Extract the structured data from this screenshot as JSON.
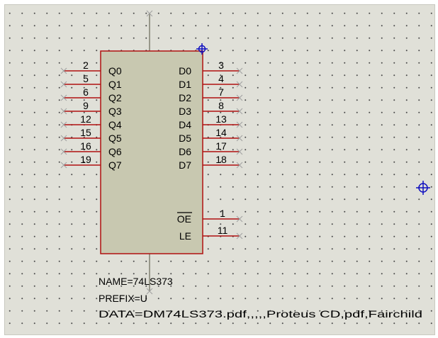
{
  "component": {
    "left_pins": [
      {
        "num": "2",
        "name": "Q0"
      },
      {
        "num": "5",
        "name": "Q1"
      },
      {
        "num": "6",
        "name": "Q2"
      },
      {
        "num": "9",
        "name": "Q3"
      },
      {
        "num": "12",
        "name": "Q4"
      },
      {
        "num": "15",
        "name": "Q5"
      },
      {
        "num": "16",
        "name": "Q6"
      },
      {
        "num": "19",
        "name": "Q7"
      }
    ],
    "right_pins": [
      {
        "num": "3",
        "name": "D0"
      },
      {
        "num": "4",
        "name": "D1"
      },
      {
        "num": "7",
        "name": "D2"
      },
      {
        "num": "8",
        "name": "D3"
      },
      {
        "num": "13",
        "name": "D4"
      },
      {
        "num": "14",
        "name": "D5"
      },
      {
        "num": "17",
        "name": "D6"
      },
      {
        "num": "18",
        "name": "D7"
      }
    ],
    "control_pins": [
      {
        "num": "1",
        "name": "OE",
        "overbar": true
      },
      {
        "num": "11",
        "name": "LE",
        "overbar": false
      }
    ],
    "properties": {
      "name": "NAME=74LS373",
      "prefix": "PREFIX=U",
      "data": "DATA=DM74LS373.pdf,,,,,Proteus CD,pdf,Fairchild"
    }
  },
  "colors": {
    "sheet": "#e0e0d8",
    "body_fill": "#c8c8b0",
    "pin_line": "#b01010",
    "pin_end": "#a0a0a0",
    "origin_marker": "#1010c0"
  }
}
